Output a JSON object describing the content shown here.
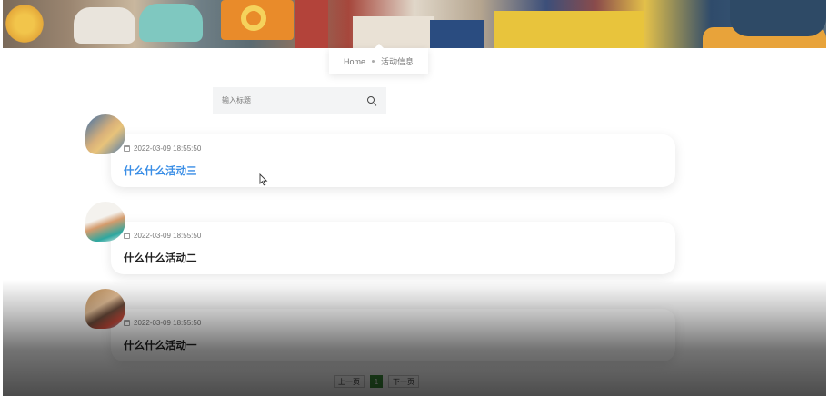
{
  "breadcrumb": {
    "home": "Home",
    "current": "活动信息"
  },
  "search": {
    "placeholder": "输入标题"
  },
  "items": [
    {
      "date": "2022-03-09 18:55:50",
      "title": "什么什么活动三"
    },
    {
      "date": "2022-03-09 18:55:50",
      "title": "什么什么活动二"
    },
    {
      "date": "2022-03-09 18:55:50",
      "title": "什么什么活动一"
    }
  ],
  "pagination": {
    "prev": "上一页",
    "page": "1",
    "next": "下一页"
  },
  "colors": {
    "accent_title": "#3a8ee6",
    "page_active": "#3c8d3a"
  },
  "icons": {
    "search": "search-icon",
    "date": "calendar-icon"
  }
}
